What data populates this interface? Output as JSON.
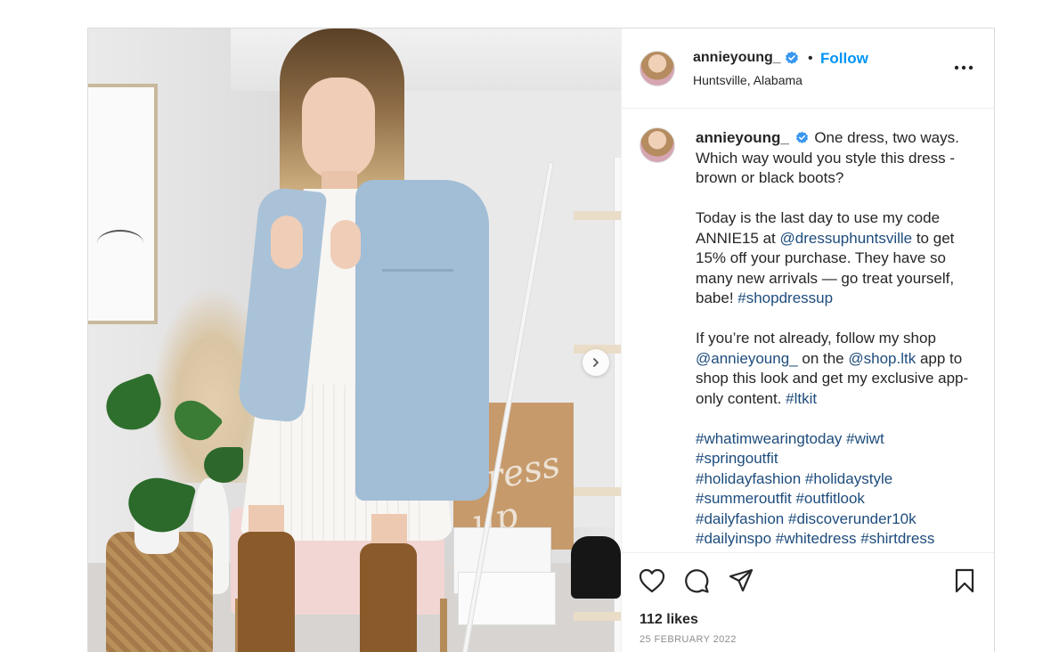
{
  "photo": {
    "alt_icon": "image",
    "carousel_next_icon": "chevron-right-icon",
    "bag_lettering": "dress up"
  },
  "header": {
    "username": "annieyoung_",
    "verified_icon": "verified-badge-icon",
    "separator": "•",
    "follow_label": "Follow",
    "location": "Huntsville, Alabama",
    "more_icon": "more-options-icon"
  },
  "caption": {
    "username": "annieyoung_",
    "p1": "One dress, two ways. Which way would you style this dress - brown or black boots?",
    "p2_before_mention": "Today is the last day to use my code ANNIE15 at ",
    "p2_mention": "@dressuphuntsville",
    "p2_after_mention": " to get 15% off your purchase. They have so many new arrivals — go treat yourself, babe! ",
    "p2_tag": "#shopdressup",
    "p3_before": "If you’re not already, follow my shop ",
    "p3_mention1": "@annieyoung_",
    "p3_mid": " on the ",
    "p3_mention2": "@shop.ltk",
    "p3_after": " app to shop this look and get my exclusive app-only content. ",
    "p3_tag": "#ltkit",
    "hashtags": [
      "#whatimwearingtoday",
      "#wiwt",
      "#springoutfit",
      "#holidayfashion",
      "#holidaystyle",
      "#summeroutfit",
      "#outfitlook",
      "#dailyfashion",
      "#discoverunder10k",
      "#dailyinspo",
      "#whitedress",
      "#shirtdress"
    ]
  },
  "actions": {
    "like_icon": "heart-icon",
    "comment_icon": "comment-icon",
    "share_icon": "share-icon",
    "save_icon": "bookmark-icon",
    "likes": "112 likes",
    "date": "25 FEBRUARY 2022"
  },
  "colors": {
    "link_blue": "#0095f6",
    "hashtag_blue": "#1e4c7c",
    "verified_blue": "#3897f0",
    "muted_gray": "#8e8e8e"
  }
}
